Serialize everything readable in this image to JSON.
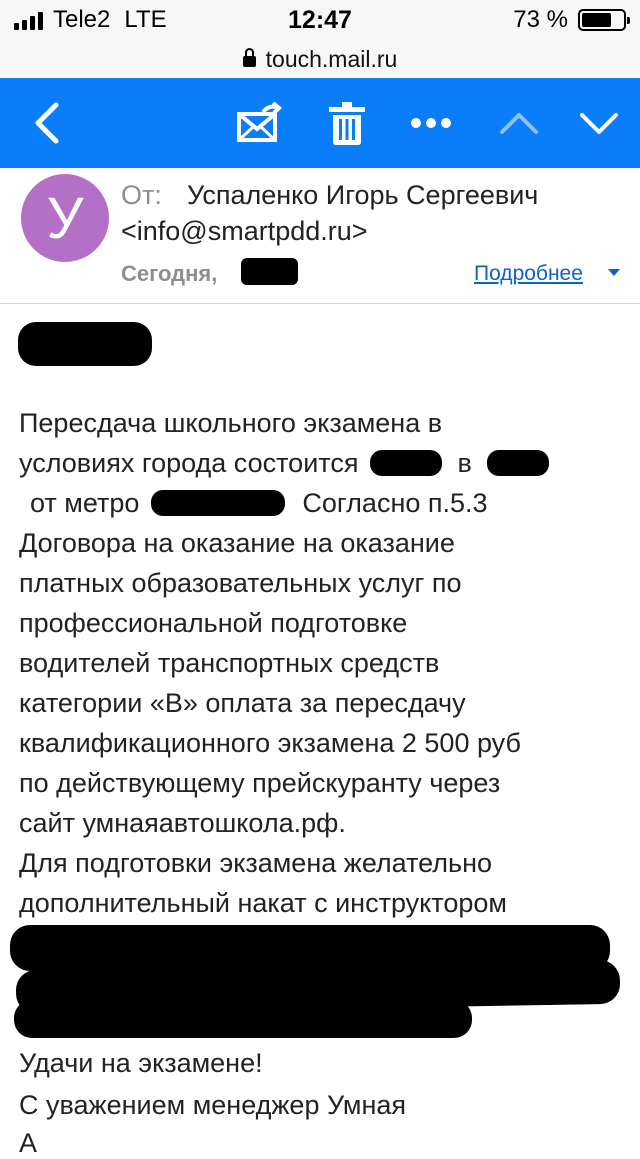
{
  "status_bar": {
    "carrier": "Tele2",
    "network": "LTE",
    "time": "12:47",
    "battery_text": "73 %",
    "battery_level": 0.73
  },
  "url_bar": {
    "url": "touch.mail.ru"
  },
  "toolbar": {
    "back_icon": "chevron-left-icon",
    "move_icon": "envelope-move-icon",
    "delete_icon": "trash-icon",
    "more_icon": "more-dots-icon",
    "prev_icon": "chevron-up-icon",
    "next_icon": "chevron-down-icon",
    "accent": "#0a7ef8"
  },
  "email": {
    "avatar_letter": "У",
    "avatar_color": "#b470c6",
    "from_label": "От:",
    "sender_name": "Успаленко Игорь Сергеевич",
    "sender_email": "<info@smartpdd.ru>",
    "date": "Сегодня,",
    "details_link": "Подробнее",
    "body": {
      "l1": "Пересдача школьного экзамена в",
      "l2a": "условиях города состоится",
      "l2b": "в",
      "l3a": "от метро",
      "l3b": "Согласно п.5.3",
      "l4": "Договора на оказание на оказание",
      "l5": "платных образовательных услуг по",
      "l6": "профессиональной подготовке",
      "l7": "водителей транспортных средств",
      "l8": "категории «В» оплата за пересдачу",
      "l9": "квалификационного экзамена 2 500 руб",
      "l10": "по действующему прейскуранту через",
      "l11": "сайт умнаяавтошкола.рф.",
      "l12": "Для подготовки экзамена желательно",
      "l13": "дополнительный накат с инструктором",
      "l14": "Удачи на экзамене!",
      "l15": "С уважением менеджер Умная",
      "l16": "А"
    }
  }
}
